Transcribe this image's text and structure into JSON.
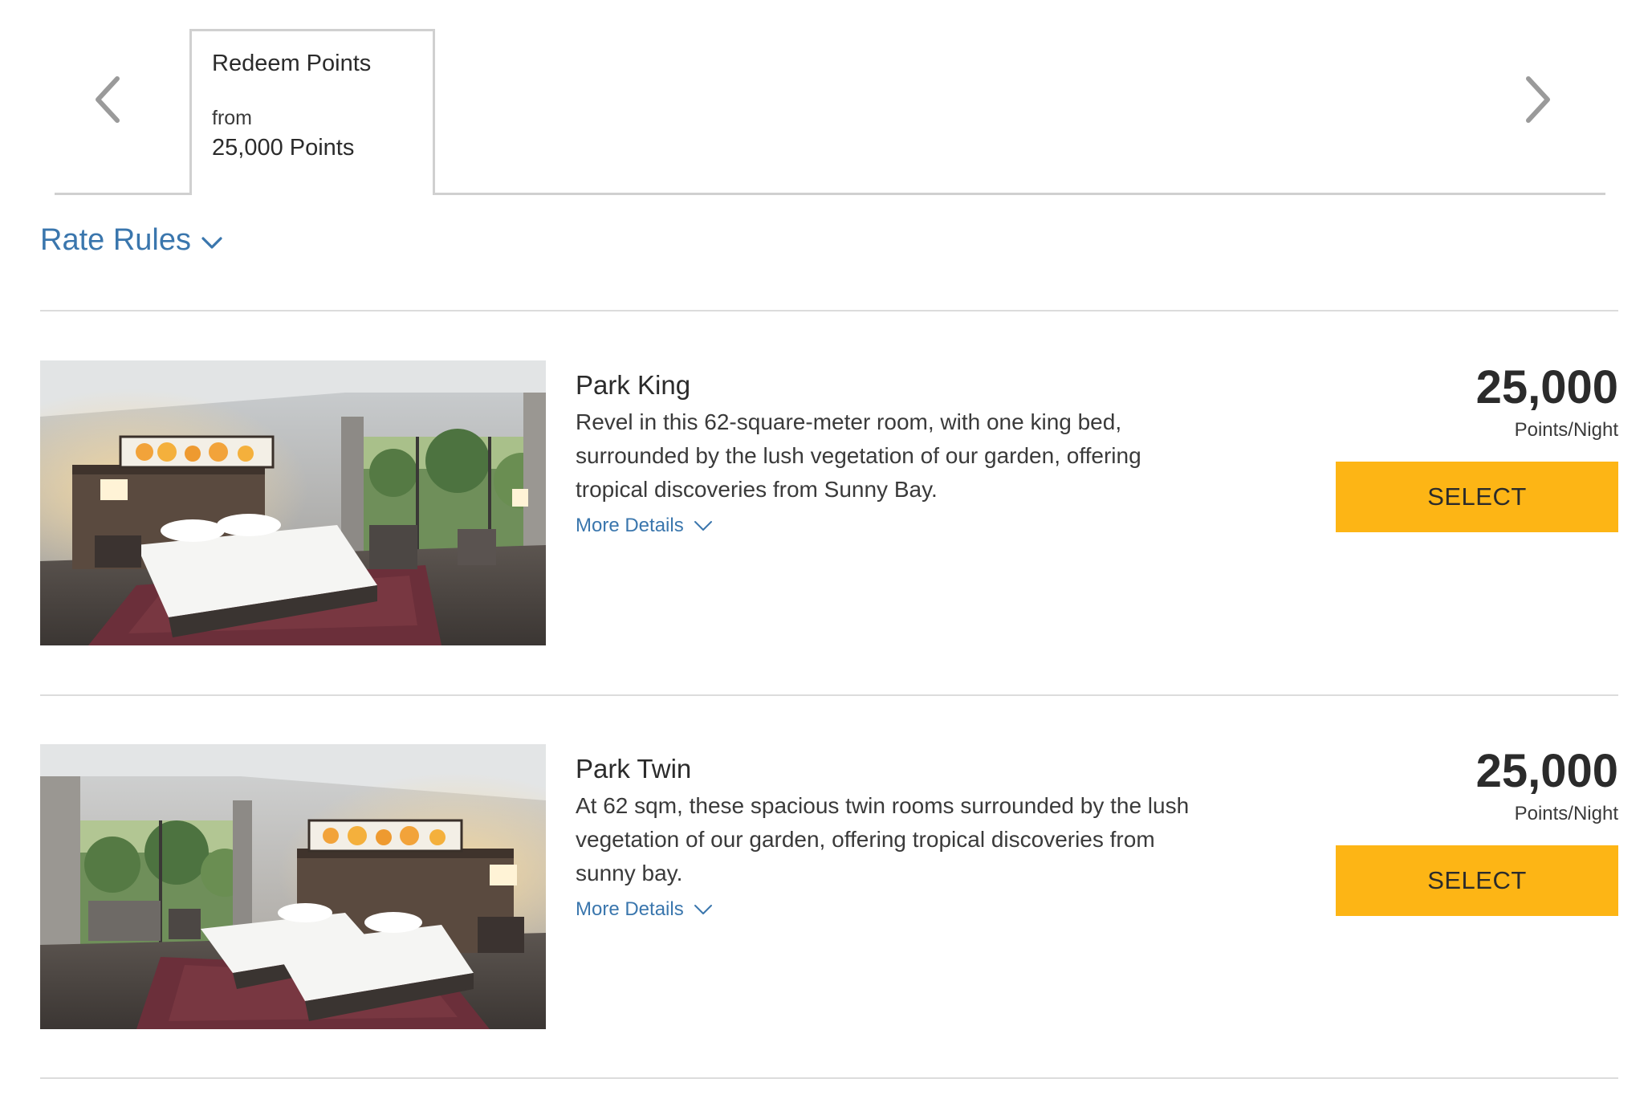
{
  "tabs": {
    "items": [
      {
        "title": "Redeem Points",
        "from_label": "from",
        "price": "25,000 Points",
        "active": true
      }
    ],
    "prev_icon": "chevron-left-icon",
    "next_icon": "chevron-right-icon"
  },
  "rate_rules": {
    "label": "Rate Rules",
    "icon": "chevron-down-icon"
  },
  "rooms": [
    {
      "name": "Park King",
      "description": "Revel in this 62-square-meter room, with one king bed, surrounded by the lush vegetation of our garden, offering tropical discoveries from Sunny Bay.",
      "more_details": "More Details",
      "price": "25,000",
      "price_unit": "Points/Night",
      "select_label": "SELECT"
    },
    {
      "name": "Park Twin",
      "description": "At 62 sqm, these spacious twin rooms surrounded by the lush vegetation of our garden, offering tropical discoveries from sunny bay.",
      "more_details": "More Details",
      "price": "25,000",
      "price_unit": "Points/Night",
      "select_label": "SELECT"
    }
  ],
  "colors": {
    "link": "#3a76ad",
    "button": "#fdb515",
    "text": "#2b2b2b",
    "divider": "#dcdcdc"
  }
}
